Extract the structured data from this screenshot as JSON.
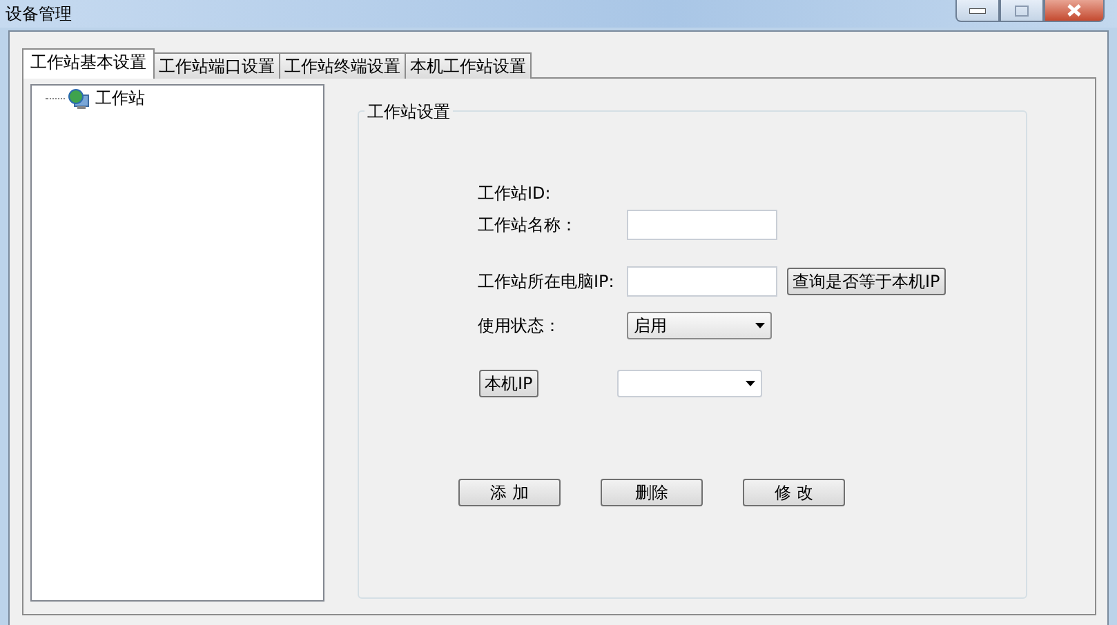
{
  "window": {
    "title": "设备管理"
  },
  "tabs": [
    {
      "label": "工作站基本设置",
      "selected": true
    },
    {
      "label": "工作站端口设置",
      "selected": false
    },
    {
      "label": "工作站终端设置",
      "selected": false
    },
    {
      "label": "本机工作站设置",
      "selected": false
    }
  ],
  "tree": {
    "items": [
      {
        "label": "工作站"
      }
    ]
  },
  "group": {
    "title": "工作站设置"
  },
  "form": {
    "rows": [
      {
        "kind": "text",
        "label": "工作站ID:"
      },
      {
        "kind": "input",
        "label": "工作站名称："
      },
      {
        "kind": "input_button",
        "label": "工作站所在电脑IP:",
        "button": "查询是否等于本机IP"
      },
      {
        "kind": "select",
        "label": "使用状态：",
        "value": "启用"
      },
      {
        "kind": "button_select",
        "button": "本机IP"
      }
    ]
  },
  "buttons": [
    "添 加",
    "删除",
    "修 改"
  ]
}
